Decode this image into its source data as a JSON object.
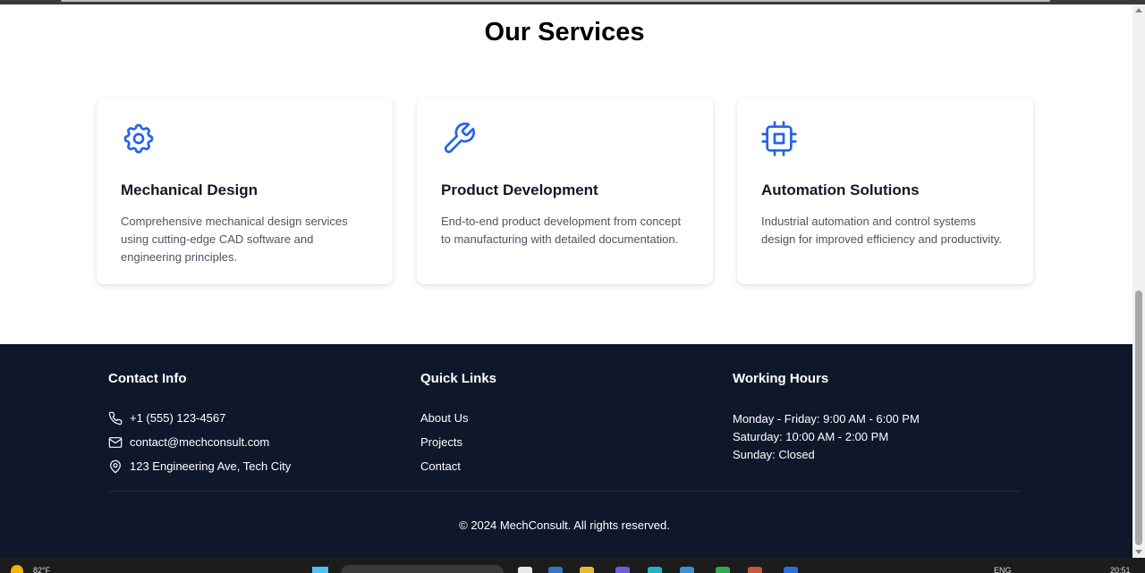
{
  "services": {
    "title": "Our Services",
    "cards": [
      {
        "icon": "gear-icon",
        "title": "Mechanical Design",
        "description": "Comprehensive mechanical design services using cutting-edge CAD software and engineering principles."
      },
      {
        "icon": "wrench-icon",
        "title": "Product Development",
        "description": "End-to-end product development from concept to manufacturing with detailed documentation."
      },
      {
        "icon": "cpu-chip-icon",
        "title": "Automation Solutions",
        "description": "Industrial automation and control systems design for improved efficiency and productivity."
      }
    ]
  },
  "footer": {
    "contact": {
      "title": "Contact Info",
      "phone": "+1 (555) 123-4567",
      "email": "contact@mechconsult.com",
      "address": "123 Engineering Ave, Tech City"
    },
    "quick_links": {
      "title": "Quick Links",
      "links": [
        "About Us",
        "Projects",
        "Contact"
      ]
    },
    "hours": {
      "title": "Working Hours",
      "lines": [
        "Monday - Friday: 9:00 AM - 6:00 PM",
        "Saturday: 10:00 AM - 2:00 PM",
        "Sunday: Closed"
      ]
    },
    "copyright": "© 2024 MechConsult. All rights reserved."
  },
  "taskbar": {
    "temperature": "82°F",
    "language": "ENG",
    "time": "20:51"
  },
  "colors": {
    "accent": "#2563eb",
    "footer_bg": "#0f172a",
    "card_text": "#4b5563"
  }
}
